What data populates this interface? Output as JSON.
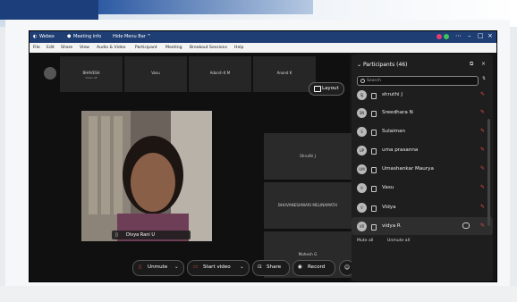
{
  "titlebar": {
    "app": "Webex",
    "meeting_info": "Meeting info",
    "hide_menu": "Hide Menu Bar ^",
    "minimize": "–",
    "maximize": "□",
    "close": "×"
  },
  "menubar": {
    "items": [
      "File",
      "Edit",
      "Share",
      "View",
      "Audio & Video",
      "Participant",
      "Meeting",
      "Breakout Sessions",
      "Help"
    ]
  },
  "strip": [
    {
      "name": "BHAVESH",
      "sub": "Video off"
    },
    {
      "name": "Vasu"
    },
    {
      "name": "Adarsh K M"
    },
    {
      "name": "Anand K"
    }
  ],
  "layout_label": "Layout",
  "main_video": {
    "name": "Divya Rani U"
  },
  "tiles": [
    "Shruthi J",
    "BHUVANESHWARI MELINAMATH",
    "Mahesh G"
  ],
  "panel": {
    "title": "Participants (46)",
    "search_placeholder": "Search",
    "rows": [
      {
        "initials": "SJ",
        "name": "shruthi J",
        "muted": true
      },
      {
        "initials": "SN",
        "name": "Sreedhara N",
        "muted": true
      },
      {
        "initials": "S",
        "name": "Sulaiman",
        "muted": true
      },
      {
        "initials": "UP",
        "name": "uma prasanna",
        "muted": true
      },
      {
        "initials": "UM",
        "name": "Umashankar Maurya",
        "muted": true
      },
      {
        "initials": "V",
        "name": "Vasu",
        "muted": true
      },
      {
        "initials": "V",
        "name": "Vidya",
        "muted": true
      },
      {
        "initials": "VR",
        "name": "vidya R",
        "muted": true
      }
    ],
    "mute_all": "Mute all",
    "unmute_all": "Unmute all"
  },
  "controls": {
    "unmute": "Unmute",
    "start_video": "Start video",
    "share": "Share",
    "record": "Record"
  },
  "colors": {
    "titlebar": "#1f3e74",
    "end_call": "#e02828",
    "muted_icon": "#e84a4a"
  }
}
